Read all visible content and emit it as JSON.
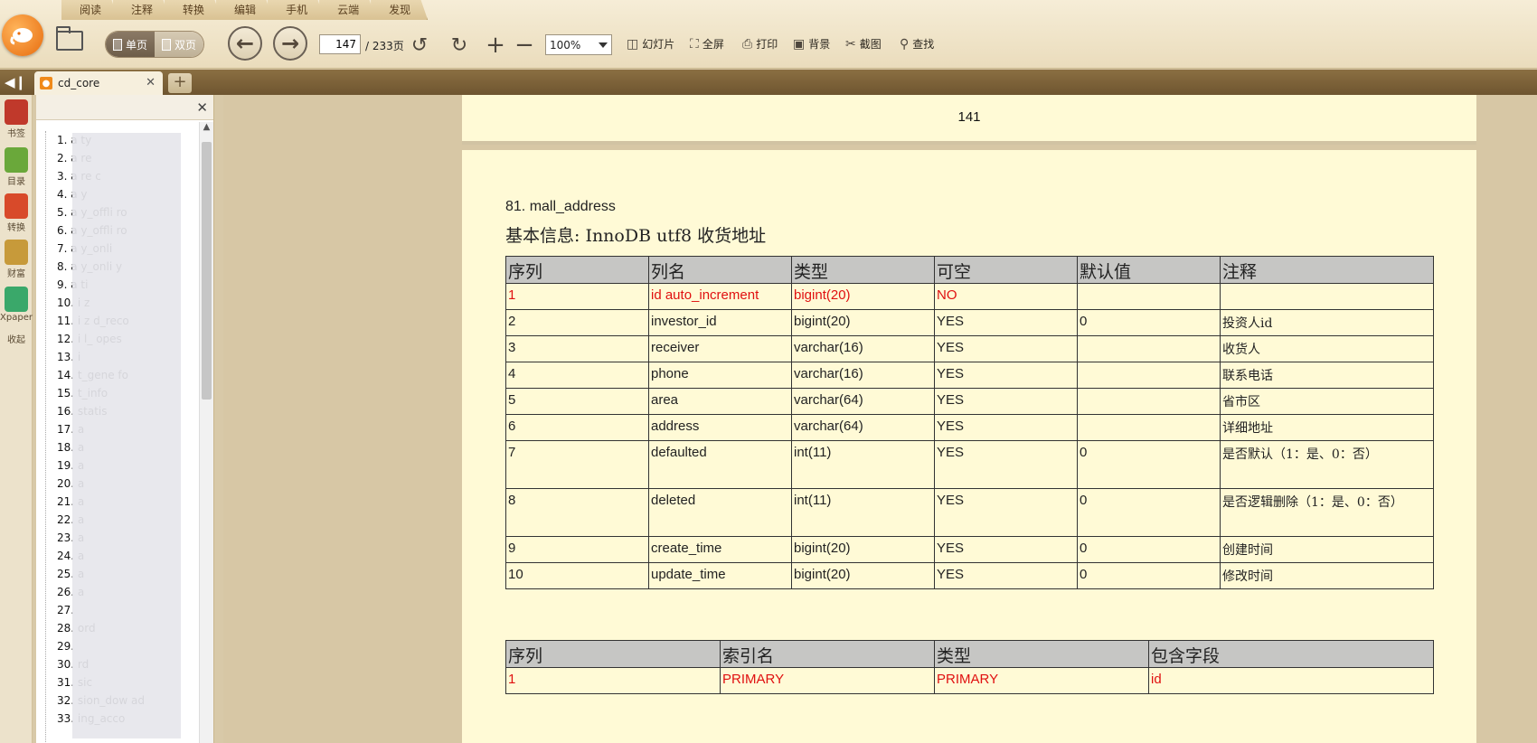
{
  "menu_tabs": [
    "阅读",
    "注释",
    "转换",
    "编辑",
    "手机",
    "云端",
    "发现"
  ],
  "toolbar": {
    "single_page": "单页",
    "double_page": "双页",
    "page_current": "147",
    "page_total": "/ 233页",
    "zoom": "100%",
    "slideshow": "幻灯片",
    "fullscreen": "全屏",
    "print": "打印",
    "background": "背景",
    "screenshot": "截图",
    "find": "查找"
  },
  "tab": {
    "title": "cd_core"
  },
  "rail": [
    {
      "label": "书签",
      "icon": "bookmark-icon",
      "color": "#c0392b"
    },
    {
      "label": "目录",
      "icon": "toc-icon",
      "color": "#6aa83a"
    },
    {
      "label": "转换",
      "icon": "convert-icon",
      "color": "#d84a2a"
    },
    {
      "label": "财富",
      "icon": "wealth-icon",
      "color": "#c79a3a"
    },
    {
      "label": "Xpaper",
      "icon": "xpaper-icon",
      "color": "#3aa86a"
    },
    {
      "label": "收起",
      "icon": "collapse-icon",
      "color": ""
    }
  ],
  "outline": [
    "1. a    ty",
    "2. a                re",
    "3. a                re       c",
    "4. a    y",
    "5. a    y_offli       ro",
    "6. a    y_offli       ro",
    "7. a    y_onli",
    "8. a    y_onli        y",
    "9. a        ti",
    "10.       i     z",
    "11.       i     z      d_reco",
    "12.       i     l_      opes",
    "13.       i",
    "14.       t_gene        fo",
    "15.       t_info",
    "16.          statis",
    "17. a",
    "18. a",
    "19. a",
    "20. a",
    "21. a",
    "22. a",
    "23. a",
    "24. a",
    "25. a",
    "26. a",
    "27.",
    "28.                        ord",
    "29.",
    "30.                        rd",
    "31.        sic",
    "32.        sion_dow         ad",
    "33.        ing_acco"
  ],
  "page_header_number": "141",
  "section": {
    "title": "81. mall_address",
    "subtitle": "基本信息: InnoDB utf8 收货地址"
  },
  "columns_table": {
    "headers": [
      "序列",
      "列名",
      "类型",
      "可空",
      "默认值",
      "注释"
    ],
    "rows": [
      [
        "1",
        "id auto_increment",
        "bigint(20)",
        "NO",
        "",
        ""
      ],
      [
        "2",
        "investor_id",
        "bigint(20)",
        "YES",
        "0",
        "投资人id"
      ],
      [
        "3",
        "receiver",
        "varchar(16)",
        "YES",
        "",
        "收货人"
      ],
      [
        "4",
        "phone",
        "varchar(16)",
        "YES",
        "",
        "联系电话"
      ],
      [
        "5",
        "area",
        "varchar(64)",
        "YES",
        "",
        "省市区"
      ],
      [
        "6",
        "address",
        "varchar(64)",
        "YES",
        "",
        "详细地址"
      ],
      [
        "7",
        "defaulted",
        "int(11)",
        "YES",
        "0",
        "是否默认（1：是、0：否）"
      ],
      [
        "8",
        "deleted",
        "int(11)",
        "YES",
        "0",
        "是否逻辑删除（1：是、0：否）"
      ],
      [
        "9",
        "create_time",
        "bigint(20)",
        "YES",
        "0",
        "创建时间"
      ],
      [
        "10",
        "update_time",
        "bigint(20)",
        "YES",
        "0",
        "修改时间"
      ]
    ]
  },
  "index_table": {
    "headers": [
      "序列",
      "索引名",
      "类型",
      "包含字段"
    ],
    "rows": [
      [
        "1",
        "PRIMARY",
        "PRIMARY",
        "id"
      ]
    ]
  }
}
